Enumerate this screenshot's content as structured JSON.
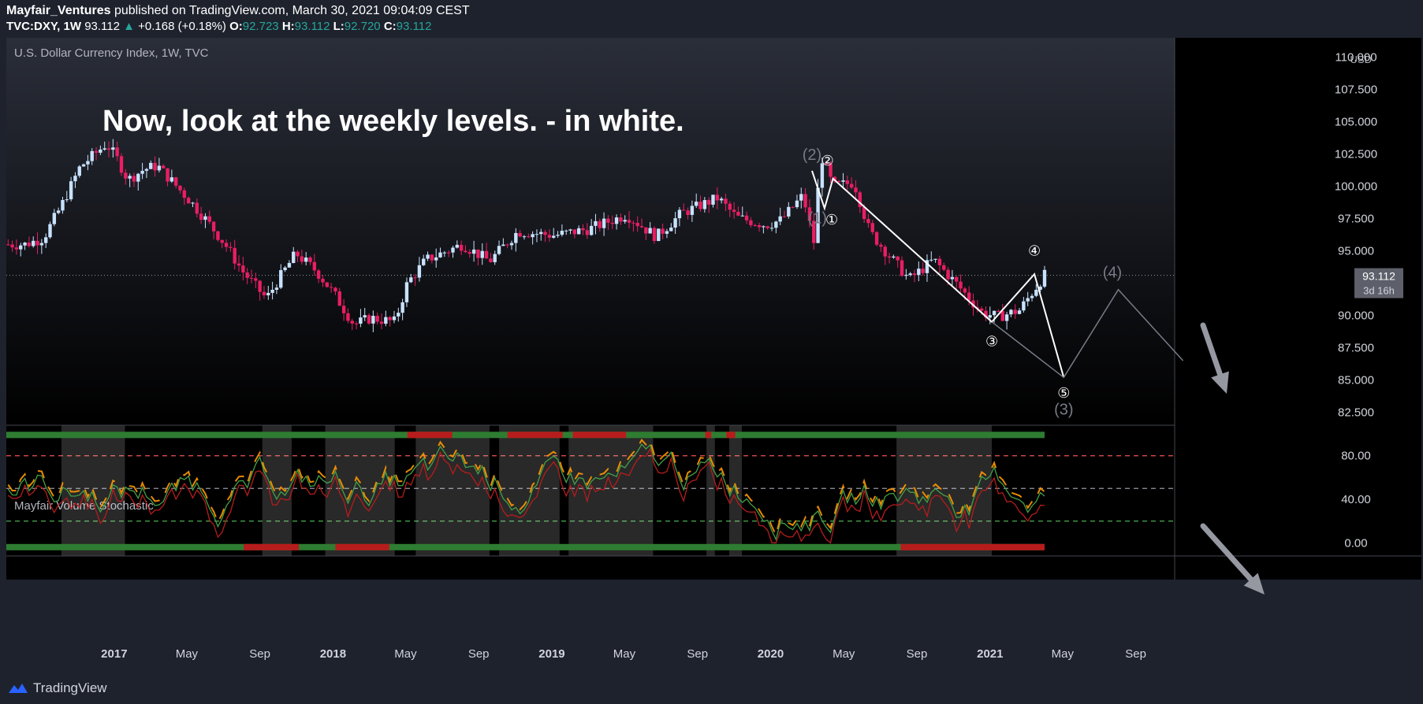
{
  "header": {
    "author": "Mayfair_Ventures",
    "published": "published on TradingView.com, March 30, 2021 09:04:09 CEST",
    "symbol": "TVC:DXY, 1W",
    "price": "93.112",
    "change": "+0.168 (+0.18%)",
    "o_label": "O:",
    "o_val": "92.723",
    "h_label": "H:",
    "h_val": "93.112",
    "l_label": "L:",
    "l_val": "92.720",
    "c_label": "C:",
    "c_val": "93.112"
  },
  "footer": {
    "brand": "TradingView"
  },
  "colors": {
    "bull": "#c8e2ff",
    "bear": "#e91e63",
    "bg_top": "#2a2e39",
    "bg_bottom": "#000000",
    "green": "#4caf50",
    "red": "#b71c1c",
    "orange": "#ff9800",
    "white": "#ffffff",
    "grey": "#787b86"
  },
  "chart_data": [
    {
      "type": "candlestick",
      "title": "U.S. Dollar Currency Index, 1W, TVC",
      "currency": "USD",
      "annotation": "Now, look at the weekly levels. - in white.",
      "ylim": [
        81.5,
        111.5
      ],
      "y_ticks": [
        "110.000",
        "107.500",
        "105.000",
        "102.500",
        "100.000",
        "97.500",
        "95.000",
        "90.000",
        "87.500",
        "85.000",
        "82.500"
      ],
      "last_price": "93.112",
      "countdown": "3d 16h",
      "x_ticks": [
        "2017",
        "May",
        "Sep",
        "2018",
        "May",
        "Sep",
        "2019",
        "May",
        "Sep",
        "2020",
        "May",
        "Sep",
        "2021",
        "May",
        "Sep"
      ],
      "x_range": [
        "2016-07",
        "2021-11"
      ],
      "close_series": [
        {
          "date": "2016-08-01",
          "v": 95.5
        },
        {
          "date": "2016-09-01",
          "v": 96.0
        },
        {
          "date": "2016-10-01",
          "v": 98.5
        },
        {
          "date": "2016-11-01",
          "v": 101.5
        },
        {
          "date": "2016-12-15",
          "v": 103.3
        },
        {
          "date": "2017-01-01",
          "v": 102.2
        },
        {
          "date": "2017-01-20",
          "v": 100.5
        },
        {
          "date": "2017-02-15",
          "v": 101.3
        },
        {
          "date": "2017-03-10",
          "v": 101.6
        },
        {
          "date": "2017-04-01",
          "v": 100.5
        },
        {
          "date": "2017-05-01",
          "v": 99.0
        },
        {
          "date": "2017-06-01",
          "v": 97.3
        },
        {
          "date": "2017-07-01",
          "v": 95.5
        },
        {
          "date": "2017-08-01",
          "v": 93.3
        },
        {
          "date": "2017-09-08",
          "v": 91.3
        },
        {
          "date": "2017-10-01",
          "v": 93.0
        },
        {
          "date": "2017-10-27",
          "v": 94.8
        },
        {
          "date": "2017-12-01",
          "v": 93.4
        },
        {
          "date": "2018-01-01",
          "v": 91.5
        },
        {
          "date": "2018-02-01",
          "v": 89.3
        },
        {
          "date": "2018-03-01",
          "v": 89.8
        },
        {
          "date": "2018-04-10",
          "v": 89.5
        },
        {
          "date": "2018-05-01",
          "v": 92.5
        },
        {
          "date": "2018-06-01",
          "v": 94.3
        },
        {
          "date": "2018-08-01",
          "v": 95.5
        },
        {
          "date": "2018-09-15",
          "v": 94.2
        },
        {
          "date": "2018-11-01",
          "v": 96.5
        },
        {
          "date": "2019-01-01",
          "v": 96.2
        },
        {
          "date": "2019-03-01",
          "v": 96.7
        },
        {
          "date": "2019-05-01",
          "v": 97.8
        },
        {
          "date": "2019-06-20",
          "v": 96.1
        },
        {
          "date": "2019-08-01",
          "v": 97.9
        },
        {
          "date": "2019-10-01",
          "v": 99.1
        },
        {
          "date": "2019-11-01",
          "v": 97.6
        },
        {
          "date": "2019-12-20",
          "v": 97.0
        },
        {
          "date": "2020-01-15",
          "v": 97.4
        },
        {
          "date": "2020-02-20",
          "v": 99.3
        },
        {
          "date": "2020-03-20",
          "v": 102.5
        },
        {
          "date": "2020-03-10",
          "v": 95.5
        },
        {
          "date": "2020-04-10",
          "v": 100.0
        },
        {
          "date": "2020-05-15",
          "v": 100.3
        },
        {
          "date": "2020-06-10",
          "v": 96.5
        },
        {
          "date": "2020-07-15",
          "v": 94.5
        },
        {
          "date": "2020-08-15",
          "v": 92.8
        },
        {
          "date": "2020-09-25",
          "v": 94.3
        },
        {
          "date": "2020-11-01",
          "v": 92.5
        },
        {
          "date": "2020-12-15",
          "v": 90.2
        },
        {
          "date": "2021-01-10",
          "v": 89.9
        },
        {
          "date": "2021-02-15",
          "v": 90.4
        },
        {
          "date": "2021-03-29",
          "v": 93.112
        }
      ],
      "wave_labels_white": [
        "①",
        "②",
        "③",
        "④",
        "⑤"
      ],
      "wave_labels_grey": [
        "(1)",
        "(2)",
        "(3)",
        "(4)"
      ],
      "white_wave_path": [
        {
          "date": "2020-03-06",
          "v": 101.2
        },
        {
          "date": "2020-03-27",
          "v": 98.3
        },
        {
          "date": "2020-04-10",
          "v": 100.6
        },
        {
          "date": "2020-12-31",
          "v": 89.5
        },
        {
          "date": "2021-03-12",
          "v": 93.2
        },
        {
          "date": "2021-04-30",
          "v": 85.2
        }
      ],
      "grey_wave_path": [
        {
          "date": "2020-12-31",
          "v": 89.5
        },
        {
          "date": "2021-04-30",
          "v": 85.2
        },
        {
          "date": "2021-07-30",
          "v": 92.0
        },
        {
          "date": "2021-11-15",
          "v": 86.5
        }
      ]
    },
    {
      "type": "line",
      "title": "Mayfair Volume Stochastic",
      "ylim": [
        -12,
        108
      ],
      "y_ticks": [
        "80.00",
        "40.00",
        "0.00"
      ],
      "levels": [
        80,
        50,
        20
      ],
      "series": []
    }
  ]
}
